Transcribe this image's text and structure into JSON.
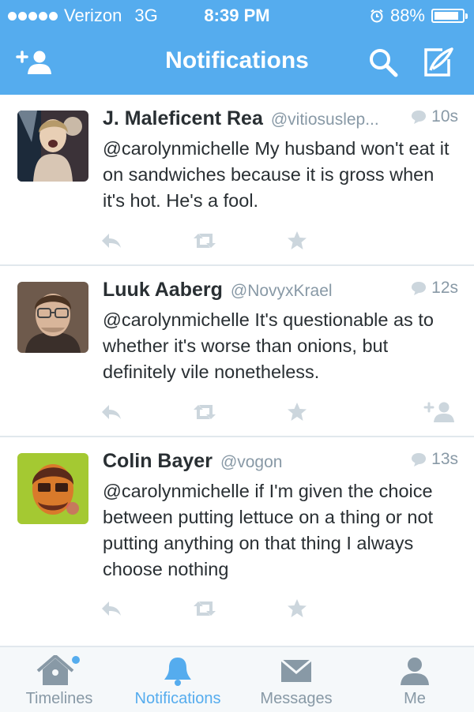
{
  "status_bar": {
    "carrier": "Verizon",
    "network": "3G",
    "time": "8:39 PM",
    "battery": "88%",
    "battery_level": 0.88,
    "signal_bars": 5
  },
  "nav": {
    "title": "Notifications",
    "left_icon": "add-user-icon",
    "right_icons": [
      "search-icon",
      "compose-icon"
    ]
  },
  "tweets": [
    {
      "name": "J. Maleficent Rea",
      "handle": "@vitiosuslep...",
      "time": "10s",
      "text": "@carolynmichelle My husband won't eat it on sandwiches because it is gross when it's hot. He's a fool.",
      "actions": [
        "reply-icon",
        "retweet-icon",
        "favorite-icon"
      ]
    },
    {
      "name": "Luuk Aaberg",
      "handle": "@NovyxKrael",
      "time": "12s",
      "text": "@carolynmichelle It's questionable as to whether it's worse than onions, but definitely vile nonetheless.",
      "actions": [
        "reply-icon",
        "retweet-icon",
        "favorite-icon",
        "follow-icon"
      ]
    },
    {
      "name": "Colin Bayer",
      "handle": "@vogon",
      "time": "13s",
      "text": "@carolynmichelle if I'm given the choice between putting lettuce on a thing or not putting anything on that thing I always choose nothing",
      "actions": [
        "reply-icon",
        "retweet-icon",
        "favorite-icon"
      ]
    }
  ],
  "tabs": [
    {
      "label": "Timelines",
      "icon": "home-icon",
      "active": false,
      "dot": true
    },
    {
      "label": "Notifications",
      "icon": "bell-icon",
      "active": true,
      "dot": false
    },
    {
      "label": "Messages",
      "icon": "envelope-icon",
      "active": false,
      "dot": false
    },
    {
      "label": "Me",
      "icon": "person-icon",
      "active": false,
      "dot": false
    }
  ],
  "colors": {
    "accent": "#55acee",
    "text": "#292f33",
    "muted": "#8899a6",
    "action_icons": "#aab8c2",
    "divider": "#e1e8ed"
  }
}
